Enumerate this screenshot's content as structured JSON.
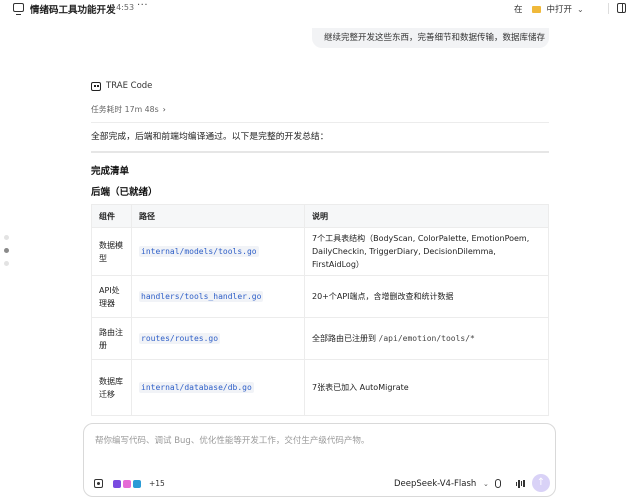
{
  "topbar": {
    "title": "情绪码工具功能开发",
    "time": "14:53",
    "more": "···",
    "open_in_label": "在",
    "open_target": "中打开"
  },
  "user_message": "继续完整开发这些东西，完善细节和数据传输，数据库储存",
  "agent": {
    "name": "TRAE Code",
    "task_time": "任务耗时 17m 48s",
    "summary": "全部完成，后端和前端均编译通过。以下是完整的开发总结：",
    "heading_checklist": "完成清单",
    "heading_backend": "后端（已就绪）"
  },
  "table": {
    "headers": [
      "组件",
      "路径",
      "说明"
    ],
    "rows": [
      {
        "component": "数据模型",
        "path": "internal/models/tools.go",
        "desc": "7个工具表结构（BodyScan, ColorPalette, EmotionPoem, DailyCheckin, TriggerDiary, DecisionDilemma, FirstAidLog）"
      },
      {
        "component": "API处理器",
        "path": "handlers/tools_handler.go",
        "desc": "20+个API端点，含增删改查和统计数据"
      },
      {
        "component": "路由注册",
        "path": "routes/routes.go",
        "desc_pre": "全部路由已注册到 ",
        "desc_code": "/api/emotion/tools/*"
      },
      {
        "component": "数据库迁移",
        "path": "internal/database/db.go",
        "desc": "7张表已加入 AutoMigrate"
      }
    ]
  },
  "composer": {
    "placeholder": "帮你编写代码、调试 Bug、优化性能等开发工作，交付生产级代码产物。",
    "more_tools": "+15",
    "model": "DeepSeek-V4-Flash",
    "send_icon": "↑"
  },
  "icons": {
    "chat": "chat-icon",
    "folder": "folder-icon",
    "layout": "layout-icon",
    "mic": "mic-icon",
    "voice": "voice-wave-icon"
  }
}
